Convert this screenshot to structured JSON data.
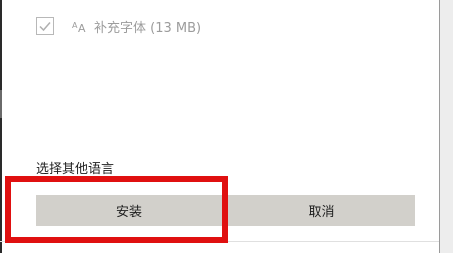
{
  "feature": {
    "checked": true,
    "icon": "font-icon",
    "label": "补充字体 (13 MB)"
  },
  "section_label": "选择其他语言",
  "buttons": {
    "install": "安装",
    "cancel": "取消"
  },
  "colors": {
    "highlight": "#e01010",
    "button_bg": "#d2d0cb",
    "disabled_text": "#9c9c9c"
  }
}
